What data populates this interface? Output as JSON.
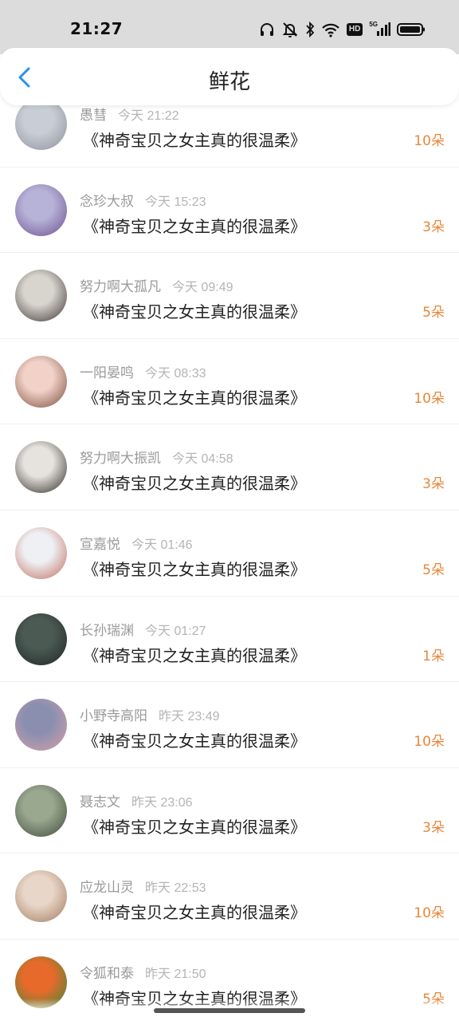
{
  "status_bar": {
    "time": "21:27",
    "hd_label": "HD",
    "network_label": "5G",
    "icons": [
      "headphones-icon",
      "mute-icon",
      "bluetooth-icon",
      "wifi-icon",
      "hd-icon",
      "signal-5g-icon",
      "battery-icon"
    ]
  },
  "nav": {
    "back_icon": "chevron-left-icon",
    "title": "鲜花",
    "accent_color": "#2a8ef0"
  },
  "list": {
    "count_color": "#e8873a",
    "items": [
      {
        "name": "愚彗",
        "time": "今天 21:22",
        "book": "《神奇宝贝之女主真的很温柔》",
        "count": "10朵",
        "avatar_colors": [
          "#c9ced6",
          "#8a8f9a"
        ]
      },
      {
        "name": "念珍大叔",
        "time": "今天 15:23",
        "book": "《神奇宝贝之女主真的很温柔》",
        "count": "3朵",
        "avatar_colors": [
          "#b7b3d8",
          "#6b4f8e"
        ]
      },
      {
        "name": "努力啊大孤凡",
        "time": "今天 09:49",
        "book": "《神奇宝贝之女主真的很温柔》",
        "count": "5朵",
        "avatar_colors": [
          "#d8d4ce",
          "#3a3330"
        ]
      },
      {
        "name": "一阳晏鸣",
        "time": "今天 08:33",
        "book": "《神奇宝贝之女主真的很温柔》",
        "count": "10朵",
        "avatar_colors": [
          "#f2d2c8",
          "#7a4a3a"
        ]
      },
      {
        "name": "努力啊大振凯",
        "time": "今天 04:58",
        "book": "《神奇宝贝之女主真的很温柔》",
        "count": "3朵",
        "avatar_colors": [
          "#e6e3de",
          "#2a2624"
        ]
      },
      {
        "name": "宣嘉悦",
        "time": "今天 01:46",
        "book": "《神奇宝贝之女主真的很温柔》",
        "count": "5朵",
        "avatar_colors": [
          "#eef0f4",
          "#c06a5a"
        ]
      },
      {
        "name": "长孙瑞渊",
        "time": "今天 01:27",
        "book": "《神奇宝贝之女主真的很温柔》",
        "count": "1朵",
        "avatar_colors": [
          "#4c5a54",
          "#1e2624"
        ]
      },
      {
        "name": "小野寺高阳",
        "time": "昨天 23:49",
        "book": "《神奇宝贝之女主真的很温柔》",
        "count": "10朵",
        "avatar_colors": [
          "#8a8fb0",
          "#d8a0a8"
        ]
      },
      {
        "name": "聂志文",
        "time": "昨天 23:06",
        "book": "《神奇宝贝之女主真的很温柔》",
        "count": "3朵",
        "avatar_colors": [
          "#9aa890",
          "#3e4a38"
        ]
      },
      {
        "name": "应龙山灵",
        "time": "昨天 22:53",
        "book": "《神奇宝贝之女主真的很温柔》",
        "count": "10朵",
        "avatar_colors": [
          "#e8d6c8",
          "#a0785a"
        ]
      },
      {
        "name": "令狐和泰",
        "time": "昨天 21:50",
        "book": "《神奇宝贝之女主真的很温柔》",
        "count": "5朵",
        "avatar_colors": [
          "#e86a2a",
          "#3a8a3a"
        ]
      }
    ]
  }
}
